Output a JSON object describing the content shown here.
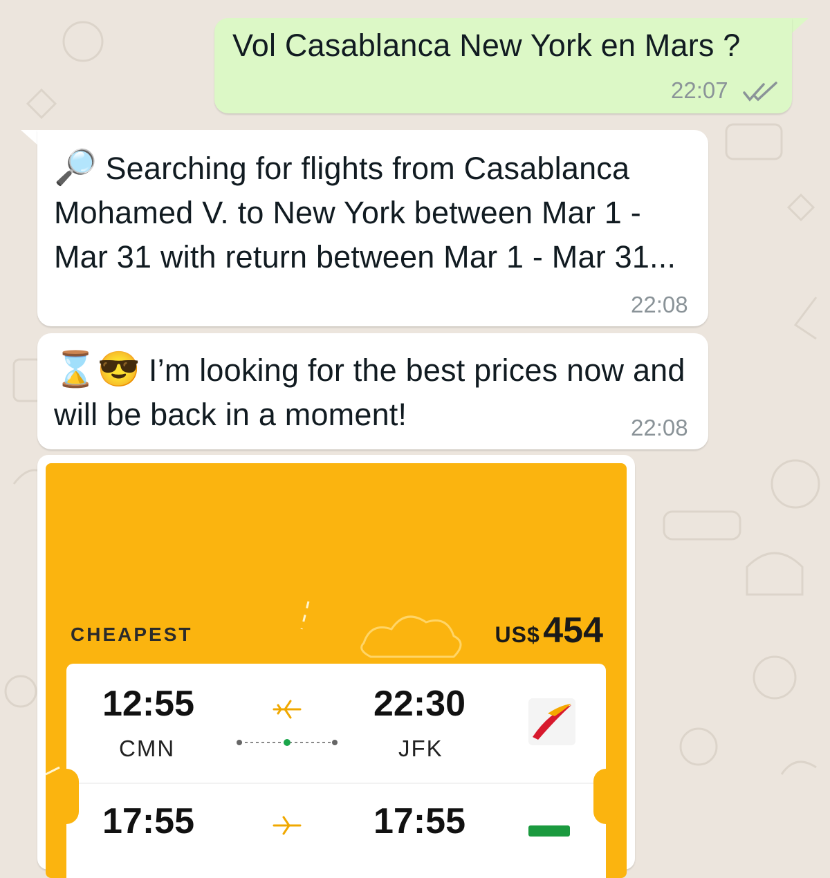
{
  "messages": {
    "outgoing_1": {
      "text": "Vol Casablanca New York en Mars ?",
      "time": "22:07",
      "status": "read"
    },
    "incoming_1": {
      "emoji": "🔎",
      "text": "Searching for flights from Casablanca Mohamed V. to New York between Mar 1 - Mar 31 with return between Mar 1 - Mar 31...",
      "time": "22:08"
    },
    "incoming_2": {
      "emoji": "⌛😎",
      "text": "I’m looking for the best prices now and will be back in a moment!",
      "time": "22:08"
    }
  },
  "flight_card": {
    "label": "CHEAPEST",
    "currency": "US$",
    "price": "454",
    "accent_color": "#fbb40f",
    "outbound": {
      "depart_time": "12:55",
      "depart_code": "CMN",
      "arrive_time": "22:30",
      "arrive_code": "JFK",
      "airline_logo": "iberia-logo"
    },
    "return": {
      "depart_time": "17:55",
      "arrive_time": "17:55",
      "airline_logo": "tap-logo"
    }
  }
}
